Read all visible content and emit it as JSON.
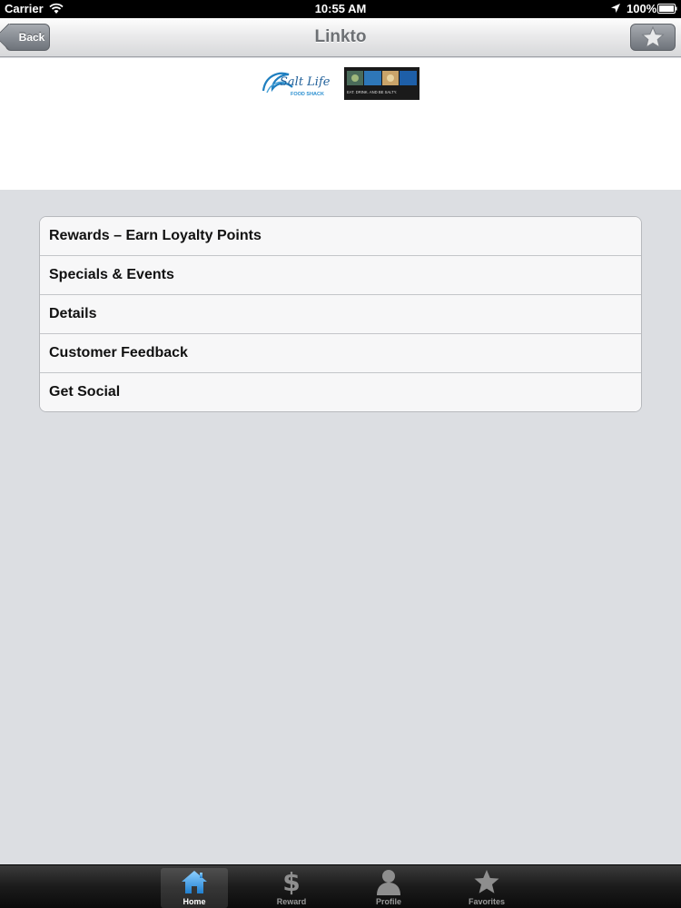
{
  "status_bar": {
    "carrier": "Carrier",
    "time": "10:55 AM",
    "battery": "100%"
  },
  "nav_bar": {
    "title": "Linkto",
    "back_label": "Back"
  },
  "header": {
    "logo_brand": "Salt Life",
    "logo_subtitle": "FOOD SHACK",
    "logo_tagline": "EAT. DRINK. AND BE SALTY."
  },
  "menu": {
    "items": [
      {
        "label": "Rewards – Earn Loyalty Points"
      },
      {
        "label": "Specials & Events"
      },
      {
        "label": "Details"
      },
      {
        "label": "Customer Feedback"
      },
      {
        "label": "Get Social"
      }
    ]
  },
  "tab_bar": {
    "tabs": [
      {
        "label": "Home",
        "icon": "home-icon",
        "selected": true
      },
      {
        "label": "Reward",
        "icon": "dollar-icon",
        "selected": false
      },
      {
        "label": "Profile",
        "icon": "profile-icon",
        "selected": false
      },
      {
        "label": "Favorites",
        "icon": "star-icon",
        "selected": false
      }
    ]
  },
  "colors": {
    "nav_title": "#6d7074",
    "background": "#dcdee2",
    "tab_selected": "#4aa3e6"
  }
}
